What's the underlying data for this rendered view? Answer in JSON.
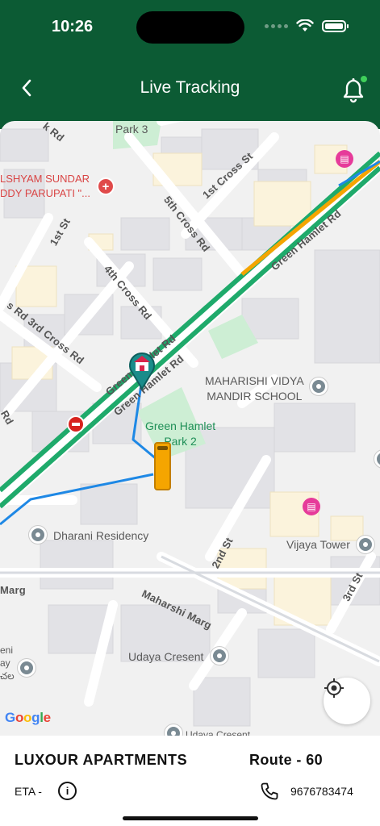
{
  "status_bar": {
    "time": "10:26"
  },
  "header": {
    "title": "Live Tracking"
  },
  "map": {
    "places": {
      "park3": "Park 3",
      "hospital": "LSHYAM SUNDAR\nDDY PARUPATI \"...",
      "school": "MAHARISHI VIDYA\nMANDIR SCHOOL",
      "park2": "Green Hamlet\nPark 2",
      "dharani": "Dharani Residency",
      "vijaya": "Vijaya Tower",
      "udaya": "Udaya Cresent",
      "udaya_bottom": "Udaya Cresent",
      "left_edge": "eni\nay\nచల"
    },
    "roads": {
      "rd_top": "k Rd",
      "first_cross": "1st Cross St",
      "fifth_cross": "5th Cross Rd",
      "first_st": "1st St",
      "fourth_cross": "4th Cross Rd",
      "third_cross": "s Rd 3rd Cross Rd",
      "gh1": "Green Hamlet Rd",
      "gh2": "Green Hamlet Rd",
      "gh3": "Green Hamlet Rd",
      "rd_left": "Rd",
      "second_st": "2nd St",
      "third_st": "3rd St",
      "maharshi": "Maharshi Marg",
      "marg": "Marg"
    },
    "attribution": "Google",
    "colors": {
      "route": "#1e88e5",
      "traffic": "#1faa6b",
      "bus": "#f5a500",
      "school_marker": "#1a8c8a"
    }
  },
  "trip": {
    "destination": "LUXOUR APARTMENTS",
    "route": "Route - 60",
    "eta_label": "ETA -",
    "phone": "9676783474"
  }
}
